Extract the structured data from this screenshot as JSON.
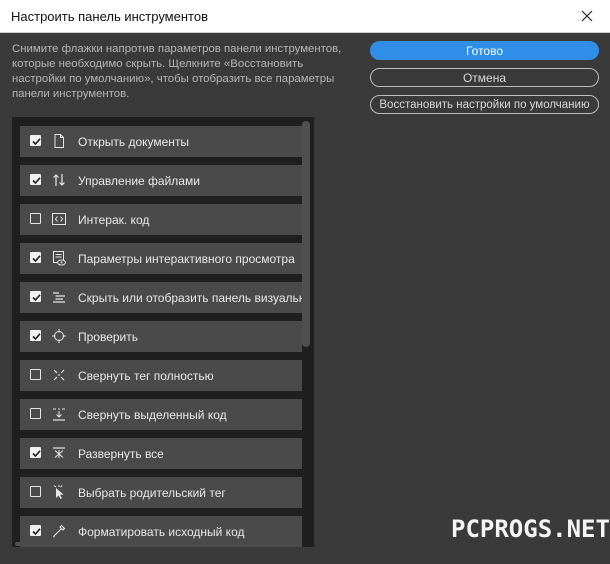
{
  "window": {
    "title": "Настроить панель инструментов",
    "close_icon": "close-icon"
  },
  "description_lines": [
    "Снимите флажки напротив параметров панели инструментов,",
    "которые необходимо скрыть. Щелкните «Восстановить",
    "настройки по умолчанию», чтобы отобразить все параметры",
    "панели инструментов."
  ],
  "buttons": {
    "done": "Готово",
    "cancel": "Отмена",
    "restore": "Восстановить настройки по умолчанию"
  },
  "items": [
    {
      "label": "Открыть документы",
      "checked": true,
      "icon": "document-icon"
    },
    {
      "label": "Управление файлами",
      "checked": true,
      "icon": "file-transfer-icon"
    },
    {
      "label": "Интерак. код",
      "checked": false,
      "icon": "code-icon"
    },
    {
      "label": "Параметры интерактивного просмотра",
      "checked": true,
      "icon": "live-view-options-icon"
    },
    {
      "label": "Скрыть или отобразить панель визуальных",
      "checked": true,
      "icon": "visual-aids-icon"
    },
    {
      "label": "Проверить",
      "checked": true,
      "icon": "inspect-icon"
    },
    {
      "label": "Свернуть тег полностью",
      "checked": false,
      "icon": "collapse-tag-icon"
    },
    {
      "label": "Свернуть выделенный код",
      "checked": false,
      "icon": "collapse-selection-icon"
    },
    {
      "label": "Развернуть все",
      "checked": true,
      "icon": "expand-all-icon"
    },
    {
      "label": "Выбрать родительский тег",
      "checked": false,
      "icon": "select-parent-tag-icon"
    },
    {
      "label": "Форматировать исходный код",
      "checked": true,
      "icon": "format-source-icon"
    }
  ],
  "watermark": "PCPROGS.NET",
  "colors": {
    "background": "#3a3a3a",
    "titlebar": "#ffffff",
    "primary": "#2f8ee8",
    "row": "#4a4a4a",
    "list_background": "#1f1f1f"
  }
}
